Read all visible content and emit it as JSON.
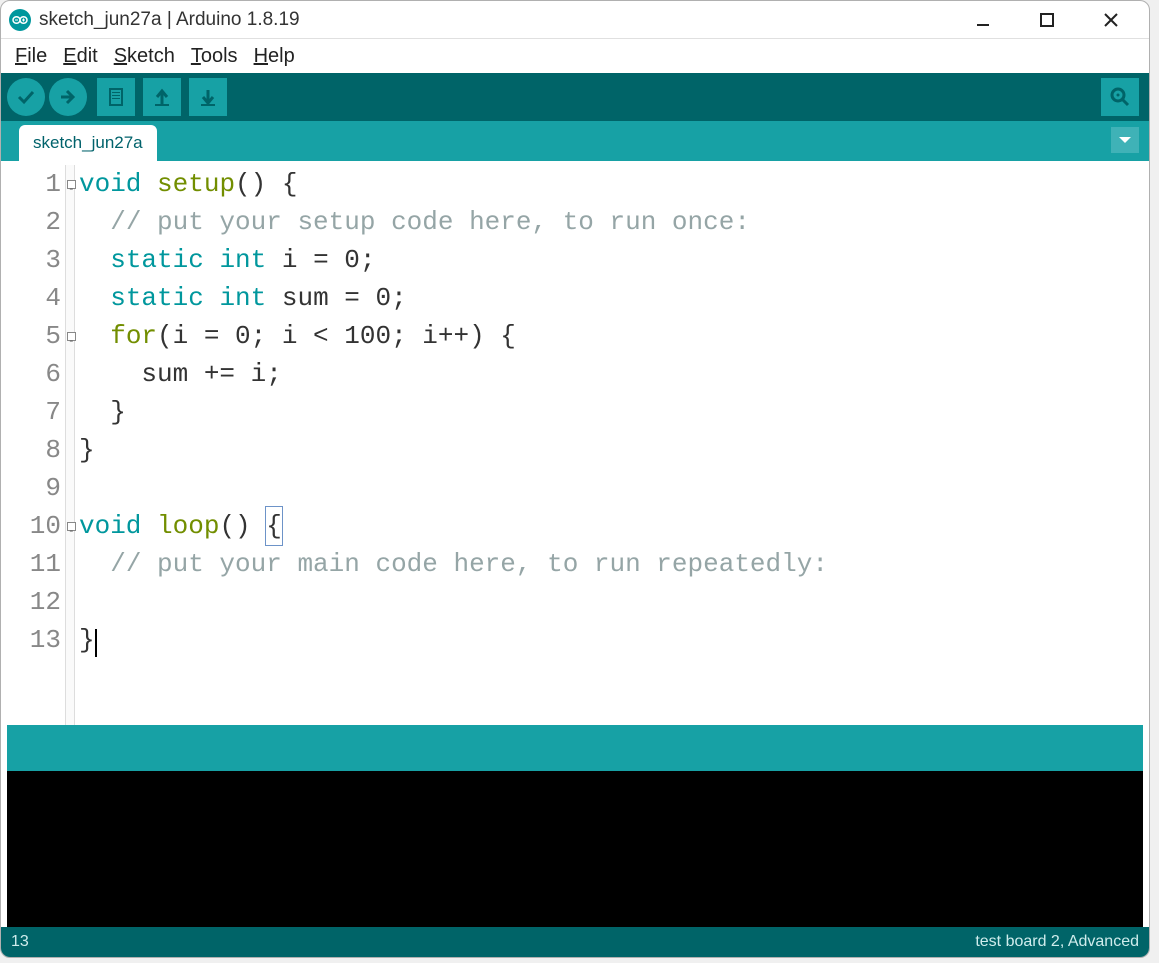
{
  "window": {
    "title": "sketch_jun27a | Arduino 1.8.19"
  },
  "menus": {
    "file": "File",
    "edit": "Edit",
    "sketch": "Sketch",
    "tools": "Tools",
    "help": "Help"
  },
  "tabs": {
    "active": "sketch_jun27a"
  },
  "code_lines": [
    {
      "n": "1",
      "fold": true,
      "tokens": [
        [
          "kw-type",
          "void"
        ],
        [
          "",
          " "
        ],
        [
          "kw-ctrl",
          "setup"
        ],
        [
          "",
          "() {"
        ]
      ]
    },
    {
      "n": "2",
      "fold": false,
      "tokens": [
        [
          "",
          "  "
        ],
        [
          "comment",
          "// put your setup code here, to run once:"
        ]
      ]
    },
    {
      "n": "3",
      "fold": false,
      "tokens": [
        [
          "",
          "  "
        ],
        [
          "kw-type",
          "static"
        ],
        [
          "",
          " "
        ],
        [
          "kw-type",
          "int"
        ],
        [
          "",
          " i = 0;"
        ]
      ]
    },
    {
      "n": "4",
      "fold": false,
      "tokens": [
        [
          "",
          "  "
        ],
        [
          "kw-type",
          "static"
        ],
        [
          "",
          " "
        ],
        [
          "kw-type",
          "int"
        ],
        [
          "",
          " sum = 0;"
        ]
      ]
    },
    {
      "n": "5",
      "fold": true,
      "tokens": [
        [
          "",
          "  "
        ],
        [
          "kw-ctrl",
          "for"
        ],
        [
          "",
          "(i = 0; i < 100; i++) {"
        ]
      ]
    },
    {
      "n": "6",
      "fold": false,
      "tokens": [
        [
          "",
          "    sum += i;"
        ]
      ]
    },
    {
      "n": "7",
      "fold": false,
      "tokens": [
        [
          "",
          "  }"
        ]
      ]
    },
    {
      "n": "8",
      "fold": false,
      "tokens": [
        [
          "",
          "}"
        ]
      ]
    },
    {
      "n": "9",
      "fold": false,
      "tokens": [
        [
          "",
          ""
        ]
      ]
    },
    {
      "n": "10",
      "fold": true,
      "tokens": [
        [
          "kw-type",
          "void"
        ],
        [
          "",
          " "
        ],
        [
          "kw-ctrl",
          "loop"
        ],
        [
          "",
          "() "
        ],
        [
          "bracket-hl",
          "{"
        ]
      ]
    },
    {
      "n": "11",
      "fold": false,
      "tokens": [
        [
          "",
          "  "
        ],
        [
          "comment",
          "// put your main code here, to run repeatedly:"
        ]
      ]
    },
    {
      "n": "12",
      "fold": false,
      "tokens": [
        [
          "",
          ""
        ]
      ]
    },
    {
      "n": "13",
      "fold": false,
      "tokens": [
        [
          "",
          "}"
        ],
        [
          "cursor",
          ""
        ]
      ]
    }
  ],
  "footer": {
    "line": "13",
    "board": "test board 2, Advanced"
  }
}
